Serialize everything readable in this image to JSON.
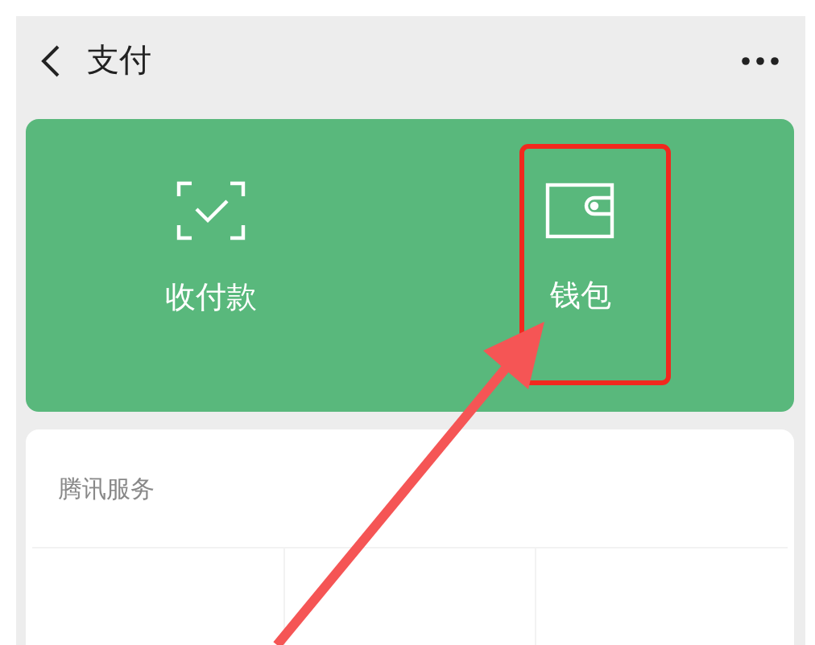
{
  "header": {
    "title": "支付"
  },
  "actions": [
    {
      "kind": "scan",
      "label": "收付款"
    },
    {
      "kind": "wallet",
      "label": "钱包"
    }
  ],
  "services": {
    "title": "腾讯服务"
  }
}
